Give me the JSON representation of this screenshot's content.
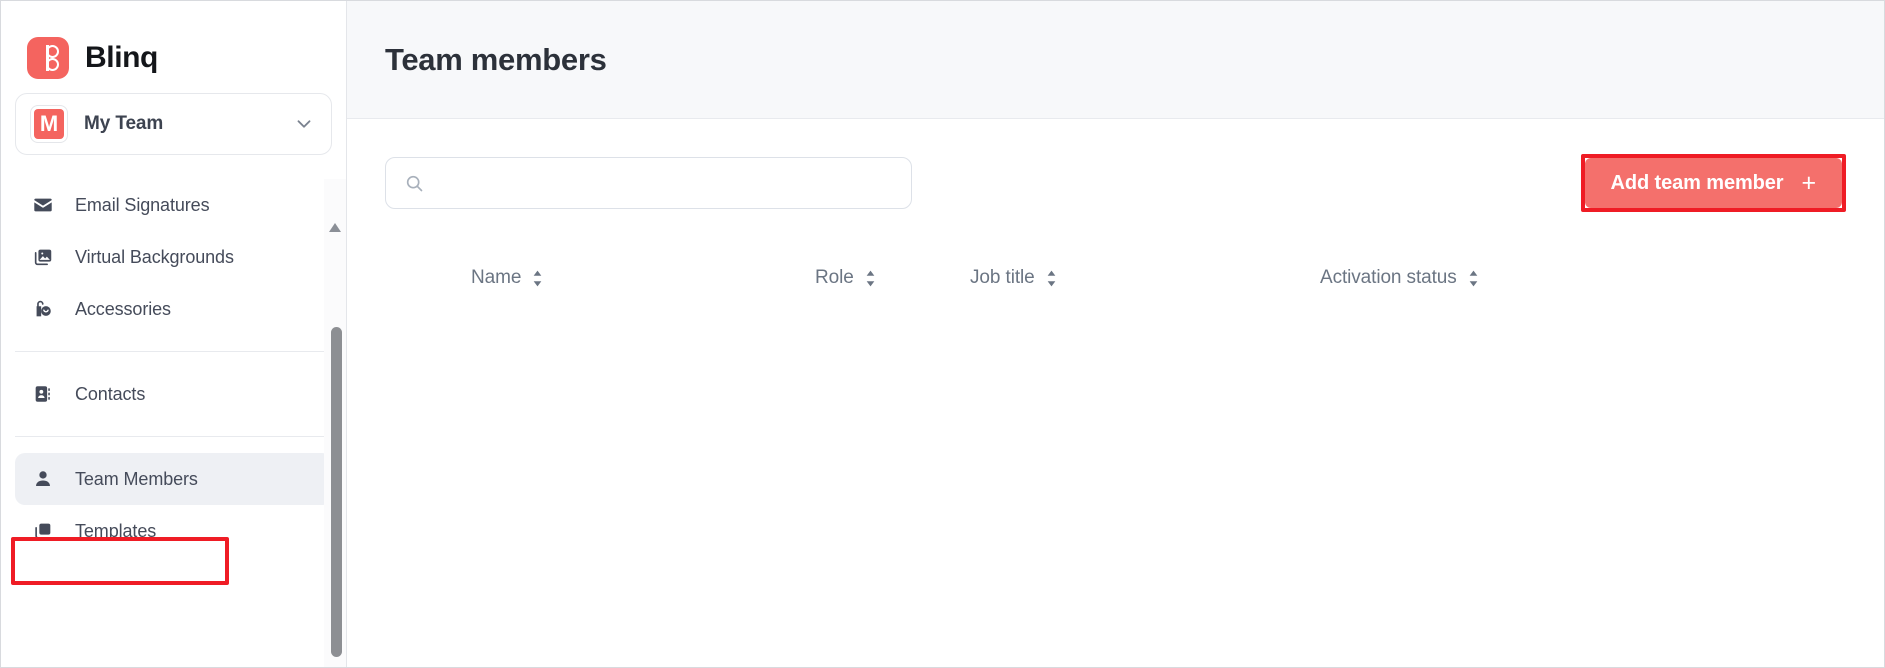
{
  "app": {
    "brand_name": "Blinq",
    "logo_color": "#f4645f",
    "accent_color": "#f4706c",
    "annotation_color": "#ef1c25"
  },
  "sidebar": {
    "team_selector": {
      "name": "My Team",
      "avatar_initial": "M",
      "chevron": "chevron-down-icon"
    },
    "groups": [
      {
        "items": [
          {
            "label": "Email Signatures",
            "icon": "envelope-icon",
            "active": false
          },
          {
            "label": "Virtual Backgrounds",
            "icon": "image-stack-icon",
            "active": false
          },
          {
            "label": "Accessories",
            "icon": "accessories-icon",
            "active": false
          }
        ]
      },
      {
        "items": [
          {
            "label": "Contacts",
            "icon": "address-book-icon",
            "active": false
          }
        ]
      },
      {
        "items": [
          {
            "label": "Team Members",
            "icon": "person-icon",
            "active": true
          },
          {
            "label": "Templates",
            "icon": "copy-icon",
            "active": false
          }
        ]
      }
    ],
    "scrollbar": {
      "up_arrow": "scroll-up-arrow-icon"
    }
  },
  "header": {
    "title": "Team members"
  },
  "toolbar": {
    "search": {
      "value": "",
      "placeholder": "",
      "icon": "search-icon"
    },
    "add_button": {
      "label": "Add team member",
      "icon": "plus-icon"
    }
  },
  "table": {
    "columns": [
      {
        "label": "Name",
        "sort": "sort-icon"
      },
      {
        "label": "Role",
        "sort": "sort-icon"
      },
      {
        "label": "Job title",
        "sort": "sort-icon"
      },
      {
        "label": "Activation status",
        "sort": "sort-icon"
      }
    ],
    "rows": []
  }
}
